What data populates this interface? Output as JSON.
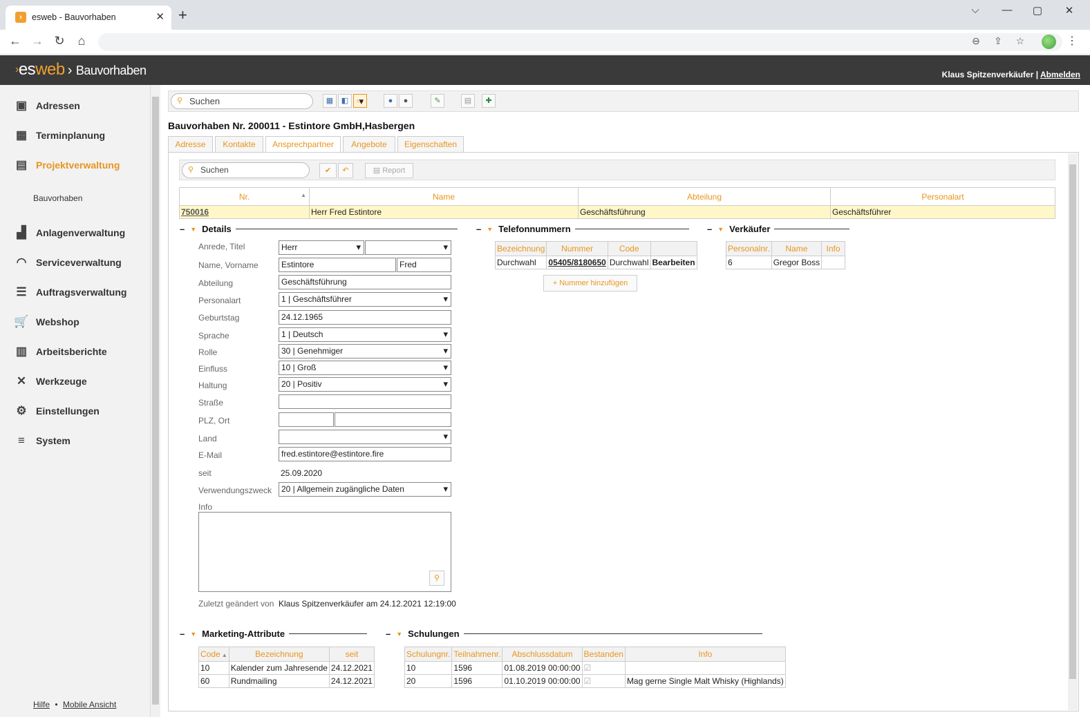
{
  "browser": {
    "tab_title": "esweb - Bauvorhaben",
    "favicon": "›",
    "new_tab": "+",
    "min": "⌵",
    "max": "▢",
    "restore": "▭",
    "close": "✕"
  },
  "app": {
    "logo_left": "es",
    "logo_right": "web",
    "page": "Bauvorhaben",
    "user": "Klaus Spitzenverkäufer",
    "separator": "|",
    "logout": "Abmelden"
  },
  "sidebar": {
    "items": [
      {
        "label": "Adressen",
        "icon": "address-book-icon"
      },
      {
        "label": "Terminplanung",
        "icon": "calendar-icon"
      },
      {
        "label": "Projektverwaltung",
        "icon": "project-icon",
        "active": true
      },
      {
        "label": "Anlagenverwaltung",
        "icon": "factory-icon"
      },
      {
        "label": "Serviceverwaltung",
        "icon": "headset-icon"
      },
      {
        "label": "Auftragsverwaltung",
        "icon": "list-icon"
      },
      {
        "label": "Webshop",
        "icon": "cart-icon"
      },
      {
        "label": "Arbeitsberichte",
        "icon": "clipboard-icon"
      },
      {
        "label": "Werkzeuge",
        "icon": "tools-icon"
      },
      {
        "label": "Einstellungen",
        "icon": "gear-icon"
      },
      {
        "label": "System",
        "icon": "database-icon"
      }
    ],
    "sub_item": "Bauvorhaben",
    "footer_help": "Hilfe",
    "footer_dot": "•",
    "footer_mobile": "Mobile Ansicht"
  },
  "toolbar": {
    "search_placeholder": "Suchen"
  },
  "page_title": "Bauvorhaben Nr. 200011 - Estintore GmbH,Hasbergen",
  "tabs": [
    "Adresse",
    "Kontakte",
    "Ansprechpartner",
    "Angebote",
    "Eigenschaften"
  ],
  "subbar": {
    "search_placeholder": "Suchen",
    "report": "Report"
  },
  "grid": {
    "headers": [
      "Nr.",
      "Name",
      "Abteilung",
      "Personalart"
    ],
    "row": {
      "nr": "750016",
      "name": "Herr Fred Estintore",
      "abteilung": "Geschäftsführung",
      "personalart": "Geschäftsführer"
    }
  },
  "details": {
    "title": "Details",
    "labels": {
      "anrede": "Anrede, Titel",
      "name": "Name, Vorname",
      "abteilung": "Abteilung",
      "personalart": "Personalart",
      "geburtstag": "Geburtstag",
      "sprache": "Sprache",
      "rolle": "Rolle",
      "einfluss": "Einfluss",
      "haltung": "Haltung",
      "strasse": "Straße",
      "plz": "PLZ, Ort",
      "land": "Land",
      "email": "E-Mail",
      "seit": "seit",
      "zweck": "Verwendungszweck",
      "info": "Info",
      "zuletzt": "Zuletzt geändert von"
    },
    "values": {
      "anrede": "Herr",
      "titel": "",
      "name": "Estintore",
      "vorname": "Fred",
      "abteilung": "Geschäftsführung",
      "personalart": "1 | Geschäftsführer",
      "geburtstag": "24.12.1965",
      "sprache": "1 | Deutsch",
      "rolle": "30 | Genehmiger",
      "einfluss": "10 | Groß",
      "haltung": "20 | Positiv",
      "strasse": "",
      "plz": "",
      "ort": "",
      "land": "",
      "email": "fred.estintore@estintore.fire",
      "seit": "25.09.2020",
      "zweck": "20 | Allgemein zugängliche Daten",
      "zuletzt": "Klaus Spitzenverkäufer am 24.12.2021 12:19:00"
    }
  },
  "telefon": {
    "title": "Telefonnummern",
    "headers": [
      "Bezeichnung",
      "Nummer",
      "Code",
      ""
    ],
    "row": {
      "bezeichnung": "Durchwahl",
      "nummer": "05405/8180650",
      "code": "Durchwahl",
      "action": "Bearbeiten"
    },
    "add_button": "Nummer hinzufügen",
    "add_icon": "+"
  },
  "verkaeufer": {
    "title": "Verkäufer",
    "headers": [
      "Personalnr.",
      "Name",
      "Info"
    ],
    "row": {
      "nr": "6",
      "name": "Gregor Boss",
      "info": ""
    }
  },
  "marketing": {
    "title": "Marketing-Attribute",
    "headers": [
      "Code",
      "Bezeichnung",
      "seit"
    ],
    "rows": [
      {
        "code": "10",
        "bez": "Kalender zum Jahresende",
        "seit": "24.12.2021"
      },
      {
        "code": "60",
        "bez": "Rundmailing",
        "seit": "24.12.2021"
      }
    ]
  },
  "schulungen": {
    "title": "Schulungen",
    "headers": [
      "Schulungnr.",
      "Teilnahmenr.",
      "Abschlussdatum",
      "Bestanden",
      "Info"
    ],
    "rows": [
      {
        "nr": "10",
        "tn": "1596",
        "datum": "01.08.2019 00:00:00",
        "info": ""
      },
      {
        "nr": "20",
        "tn": "1596",
        "datum": "01.10.2019 00:00:00",
        "info": "Mag gerne Single Malt Whisky (Highlands)"
      }
    ]
  }
}
